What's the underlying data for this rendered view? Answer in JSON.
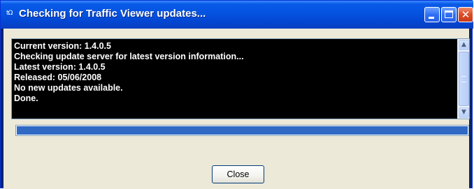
{
  "window": {
    "title": "Checking for Traffic Viewer updates...",
    "app_icon_text": "tΩ",
    "controls": {
      "minimize": "minimize",
      "maximize": "maximize",
      "close": "close"
    }
  },
  "console": {
    "lines": [
      "Current version: 1.4.0.5",
      "Checking update server for latest version information...",
      "Latest version: 1.4.0.5",
      "Released: 05/06/2008",
      "No new updates available.",
      "Done."
    ]
  },
  "progress": {
    "fraction": 1.0
  },
  "buttons": {
    "close_label": "Close"
  },
  "icons": {
    "app": "app-icon",
    "minimize": "minimize-icon",
    "maximize": "maximize-icon",
    "close": "close-icon",
    "scroll_up": "scroll-up-icon",
    "scroll_down": "scroll-down-icon"
  },
  "colors": {
    "titlebar": "#0453e0",
    "console_bg": "#000000",
    "console_text": "#ffffff",
    "progress_fill": "#316ac5",
    "client_bg": "#ece9d8"
  }
}
